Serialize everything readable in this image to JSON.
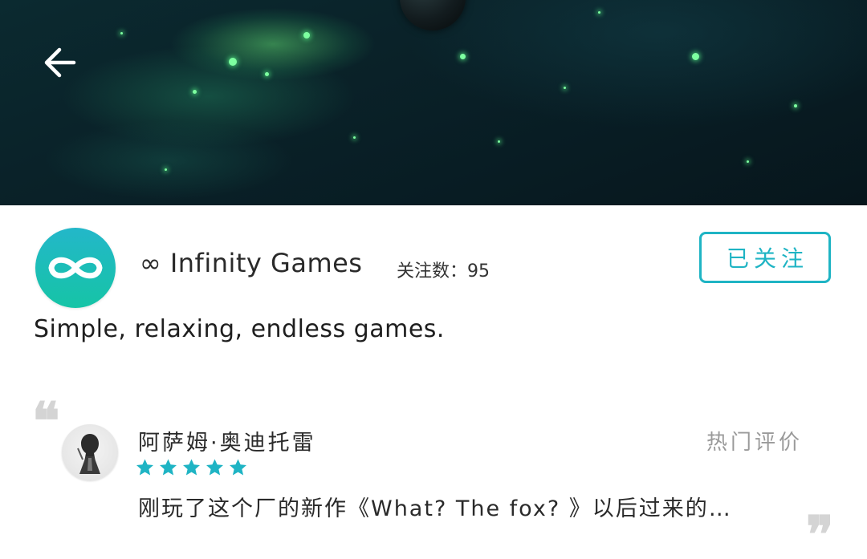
{
  "header": {
    "back_icon": "arrow-left-icon"
  },
  "developer": {
    "logo_icon": "infinity-icon",
    "name": "∞ Infinity Games",
    "followers_label": "关注数：",
    "followers_count": "95",
    "follow_button_label": "已关注",
    "description": "Simple, relaxing, endless games."
  },
  "review": {
    "section_label": "热门评价",
    "reviewer_name": "阿萨姆·奥迪托雷",
    "rating": 5,
    "rating_max": 5,
    "text": "刚玩了这个厂的新作《What? The fox? 》以后过来的…",
    "open_quote": "❝",
    "close_quote": "❞"
  },
  "colors": {
    "accent": "#1fb4c4",
    "star": "#1fb4c4",
    "muted_text": "#9a9a9a",
    "quote_mark": "#d4d4d4"
  }
}
